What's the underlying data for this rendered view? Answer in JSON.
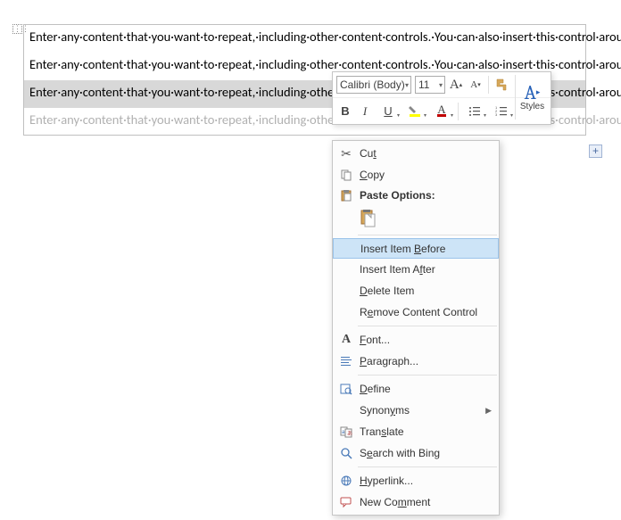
{
  "doc": {
    "paragraph": "Enter·any·content·that·you·want·to·repeat,·including·other·content·controls.·You·can·also·insert·this·control·around·table·rows·in·order·to·repeat·parts·of·a·table.¶"
  },
  "toolbar": {
    "font_name": "Calibri (Body)",
    "font_size": "11",
    "grow": "A",
    "shrink": "A",
    "bold": "B",
    "italic": "I",
    "underline": "U",
    "styles_label": "Styles"
  },
  "menu": {
    "cut": "Cut",
    "copy": "Copy",
    "paste_options": "Paste Options:",
    "insert_before": "Insert Item Before",
    "insert_after": "Insert Item After",
    "delete_item": "Delete Item",
    "remove_cc": "Remove Content Control",
    "font": "Font...",
    "paragraph": "Paragraph...",
    "define": "Define",
    "synonyms": "Synonyms",
    "translate": "Translate",
    "search_bing": "Search with Bing",
    "hyperlink": "Hyperlink...",
    "new_comment": "New Comment"
  }
}
